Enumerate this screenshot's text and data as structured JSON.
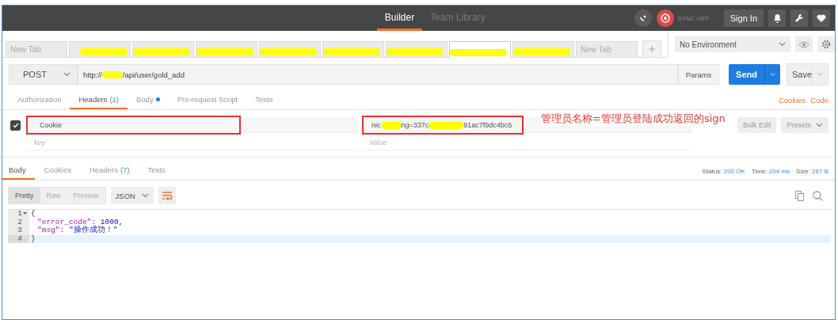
{
  "topbar": {
    "nav": [
      {
        "label": "Builder",
        "selected": true
      },
      {
        "label": "Team Library",
        "selected": false
      }
    ],
    "sync_label": "SYNC OFF",
    "sign_in": "Sign In"
  },
  "request_tabs": [
    {
      "label": "New Tab",
      "selected": false
    },
    {
      "redacted": true,
      "selected": false
    },
    {
      "redacted": true,
      "selected": false
    },
    {
      "redacted": true,
      "selected": false
    },
    {
      "redacted": true,
      "selected": false
    },
    {
      "redacted": true,
      "selected": false
    },
    {
      "redacted": true,
      "selected": false
    },
    {
      "redacted": true,
      "selected": true
    },
    {
      "redacted": true,
      "selected": false
    },
    {
      "label": "New Tab",
      "selected": false
    }
  ],
  "environment": "No Environment",
  "request": {
    "method": "POST",
    "url": [
      {
        "kind": "text",
        "text": "http://"
      },
      {
        "kind": "redaction"
      },
      {
        "kind": "text",
        "text": "/api/user/gold_add"
      }
    ],
    "params": "Params",
    "send": "Send",
    "save": "Save"
  },
  "builder_tabs": [
    {
      "label": "Authorization",
      "selected": false
    },
    {
      "label": "Headers",
      "count": "(1)",
      "selected": true
    },
    {
      "label": "Body",
      "dot": true,
      "selected": false
    },
    {
      "label": "Pre-request Script",
      "selected": false
    },
    {
      "label": "Tests",
      "selected": false
    }
  ],
  "builder_links": [
    "Cookies",
    "Code"
  ],
  "headers": {
    "rows": [
      {
        "checked": true,
        "key": "Cookie",
        "highlighted": true,
        "value": [
          {
            "kind": "text",
            "text": "nic"
          },
          {
            "kind": "redaction"
          },
          {
            "kind": "text",
            "text": "ng=337c"
          },
          {
            "kind": "redaction"
          },
          {
            "kind": "text",
            "text": "91ac7f9dc4bc6"
          }
        ]
      }
    ],
    "key_placeholder": "key",
    "value_placeholder": "value",
    "bulk_edit": "Bulk Edit",
    "presets": "Presets"
  },
  "annotation": "管理员名称=管理员登陆成功返回的sign",
  "response_tabs": [
    {
      "label": "Body",
      "selected": true
    },
    {
      "label": "Cookies",
      "selected": false
    },
    {
      "label": "Headers",
      "count": "(7)",
      "selected": false
    },
    {
      "label": "Tests",
      "selected": false
    }
  ],
  "status": [
    {
      "label": "Status:",
      "value": "200 OK"
    },
    {
      "label": "Time:",
      "value": "204 ms"
    },
    {
      "label": "Size:",
      "value": "287 B"
    }
  ],
  "views": [
    {
      "label": "Pretty",
      "selected": true
    },
    {
      "label": "Raw",
      "selected": false
    },
    {
      "label": "Preview",
      "selected": false
    }
  ],
  "format": "JSON",
  "code": [
    {
      "number": "1",
      "foldable": true,
      "current": false,
      "tokens": [
        {
          "kind": "punct",
          "text": "{"
        }
      ]
    },
    {
      "number": "2",
      "foldable": false,
      "current": false,
      "tokens": [
        {
          "kind": "key",
          "text": "\"error_code\""
        },
        {
          "kind": "punct",
          "text": ": "
        },
        {
          "kind": "number",
          "text": "1000"
        },
        {
          "kind": "punct",
          "text": ","
        }
      ]
    },
    {
      "number": "3",
      "foldable": false,
      "current": false,
      "tokens": [
        {
          "kind": "key",
          "text": "\"msg\""
        },
        {
          "kind": "punct",
          "text": ": "
        },
        {
          "kind": "string",
          "text": "\"操作成功！\""
        }
      ]
    },
    {
      "number": "4",
      "foldable": false,
      "current": true,
      "tokens": [
        {
          "kind": "punct",
          "text": "}"
        }
      ]
    }
  ]
}
